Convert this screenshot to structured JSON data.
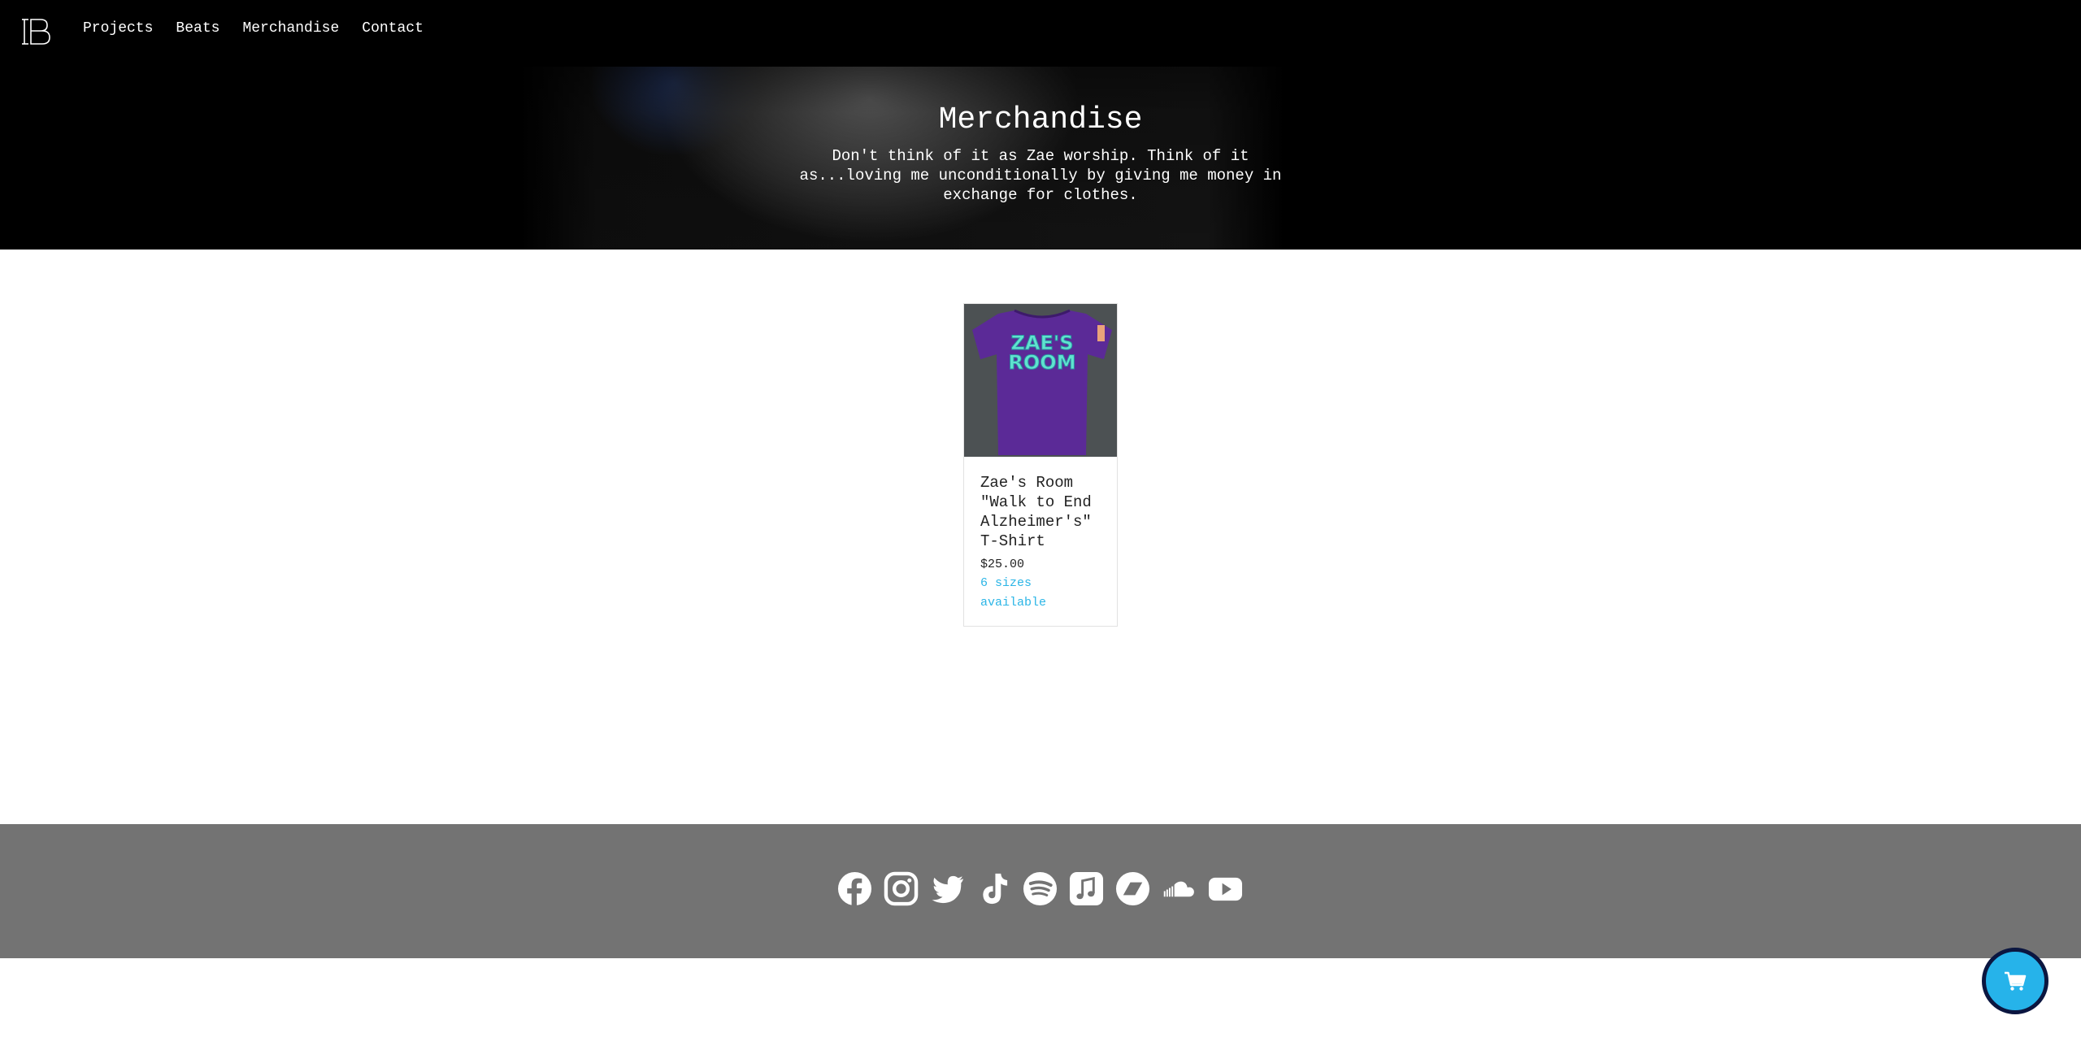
{
  "nav": {
    "logo_text": "IB",
    "links": [
      {
        "label": "Projects"
      },
      {
        "label": "Beats"
      },
      {
        "label": "Merchandise"
      },
      {
        "label": "Contact"
      }
    ]
  },
  "hero": {
    "title": "Merchandise",
    "subtitle": "Don't think of it as Zae worship. Think of it as...loving me unconditionally by giving me money in exchange for clothes."
  },
  "products": [
    {
      "name": "Zae's Room \"Walk to End Alzheimer's\" T-Shirt",
      "price": "$25.00",
      "sizes": "6 sizes available",
      "shirt_color": "#5b2a97",
      "print_text": "ZAE'S ROOM",
      "print_color": "#5fe3cf"
    }
  ],
  "footer": {
    "socials": [
      "facebook-icon",
      "instagram-icon",
      "twitter-icon",
      "tiktok-icon",
      "spotify-icon",
      "apple-music-icon",
      "bandcamp-icon",
      "soundcloud-icon",
      "youtube-icon"
    ]
  },
  "colors": {
    "accent": "#2bb5e6",
    "cart_bg": "#26b3ea",
    "cart_border": "#0b1640",
    "footer_bg": "#737373"
  }
}
